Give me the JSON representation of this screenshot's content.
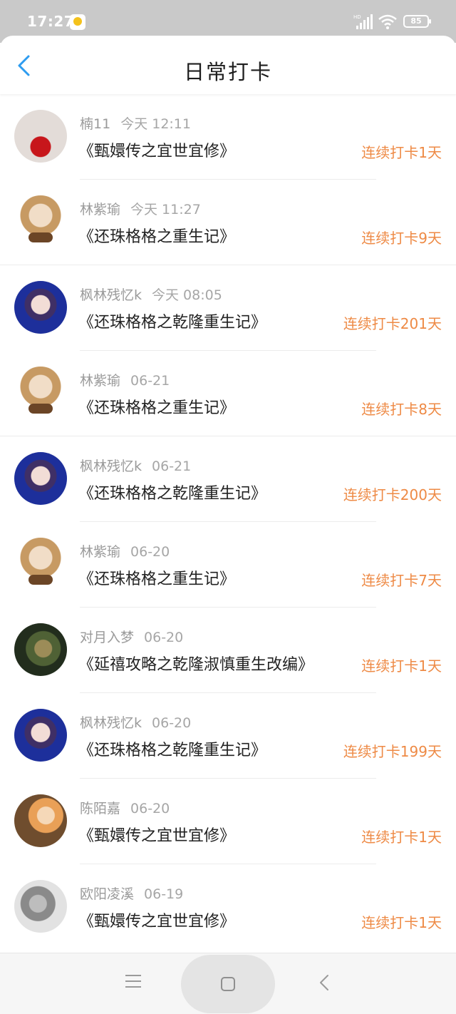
{
  "statusbar": {
    "time": "17:27",
    "battery": "85",
    "icons": [
      "app-icon",
      "signal-icon",
      "wifi-icon",
      "battery-icon"
    ]
  },
  "header": {
    "title": "日常打卡",
    "back_icon": "chevron-left-icon",
    "accent": "#2d9cf0"
  },
  "list": {
    "streak_color": "#ee8a45",
    "items": [
      {
        "name": "楠11",
        "date": "今天 12:11",
        "book": "《甄嬛传之宜世宜修》",
        "streak": "连续打卡1天",
        "avatar": "apple-photo"
      },
      {
        "name": "林紫瑜",
        "date": "今天 11:27",
        "book": "《还珠格格之重生记》",
        "streak": "连续打卡9天",
        "avatar": "anime-character"
      },
      {
        "name": "枫林残忆k",
        "date": "今天 08:05",
        "book": "《还珠格格之乾隆重生记》",
        "streak": "连续打卡201天",
        "avatar": "fairy-portrait"
      },
      {
        "name": "林紫瑜",
        "date": "06-21",
        "book": "《还珠格格之重生记》",
        "streak": "连续打卡8天",
        "avatar": "anime-character"
      },
      {
        "name": "枫林残忆k",
        "date": "06-21",
        "book": "《还珠格格之乾隆重生记》",
        "streak": "连续打卡200天",
        "avatar": "fairy-portrait"
      },
      {
        "name": "林紫瑜",
        "date": "06-20",
        "book": "《还珠格格之重生记》",
        "streak": "连续打卡7天",
        "avatar": "anime-character"
      },
      {
        "name": "对月入梦",
        "date": "06-20",
        "book": "《延禧攻略之乾隆淑慎重生改编》",
        "streak": "连续打卡1天",
        "avatar": "forest-character"
      },
      {
        "name": "枫林残忆k",
        "date": "06-20",
        "book": "《还珠格格之乾隆重生记》",
        "streak": "连续打卡199天",
        "avatar": "fairy-portrait"
      },
      {
        "name": "陈陌嘉",
        "date": "06-20",
        "book": "《甄嬛传之宜世宜修》",
        "streak": "连续打卡1天",
        "avatar": "sunset-portrait"
      },
      {
        "name": "欧阳凌溪",
        "date": "06-19",
        "book": "《甄嬛传之宜世宜修》",
        "streak": "连续打卡1天",
        "avatar": "grayscale-portrait"
      }
    ]
  },
  "navbar": {
    "icons": [
      "menu-icon",
      "home-icon",
      "back-icon"
    ]
  }
}
